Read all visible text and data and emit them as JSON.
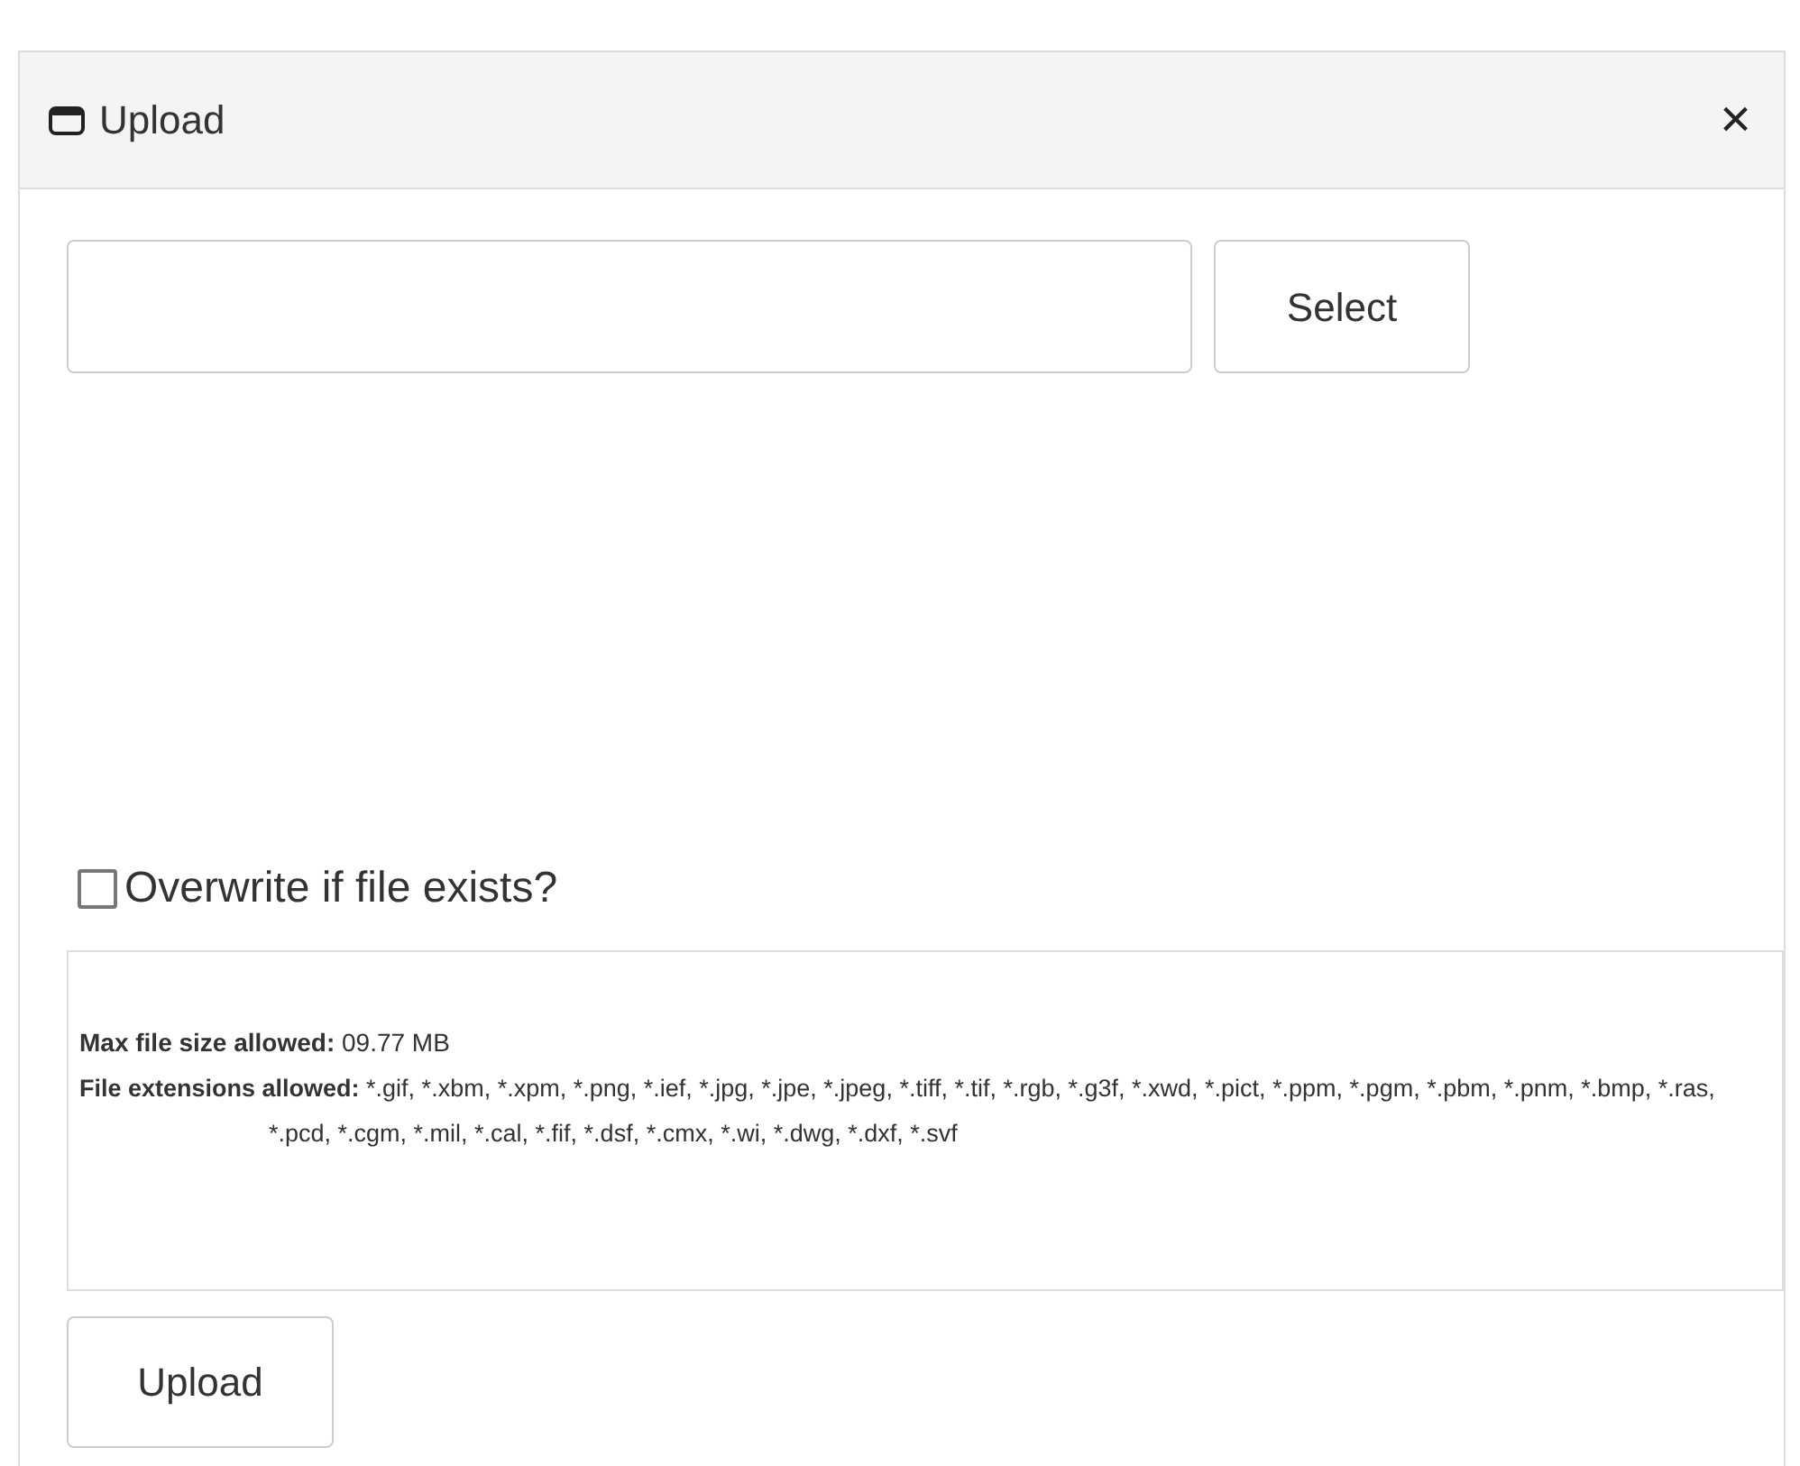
{
  "dialog": {
    "title": "Upload",
    "close": "×"
  },
  "select_button": "Select",
  "overwrite": {
    "label": "Overwrite if file exists?",
    "checked": false
  },
  "info": {
    "max_size": "**Max file size allowed:** 09.77 MB",
    "extensions": "**File extensions allowed:** *.gif, *.xbm, *.xpm, *.png, *.ief, *.jpg, *.jpe, *.jpeg, *.tiff, *.tif, *.rgb, *.g3f, *.xwd, *.pict, *.ppm, *.pgm, *.pbm, *.pnm, *.bmp, *.ras, *.pcd, *.cgm, *.mil, *.cal, *.fif, *.dsf, *.cmx, *.wi, *.dwg, *.dxf, *.svf"
  },
  "upload_button": "Upload"
}
